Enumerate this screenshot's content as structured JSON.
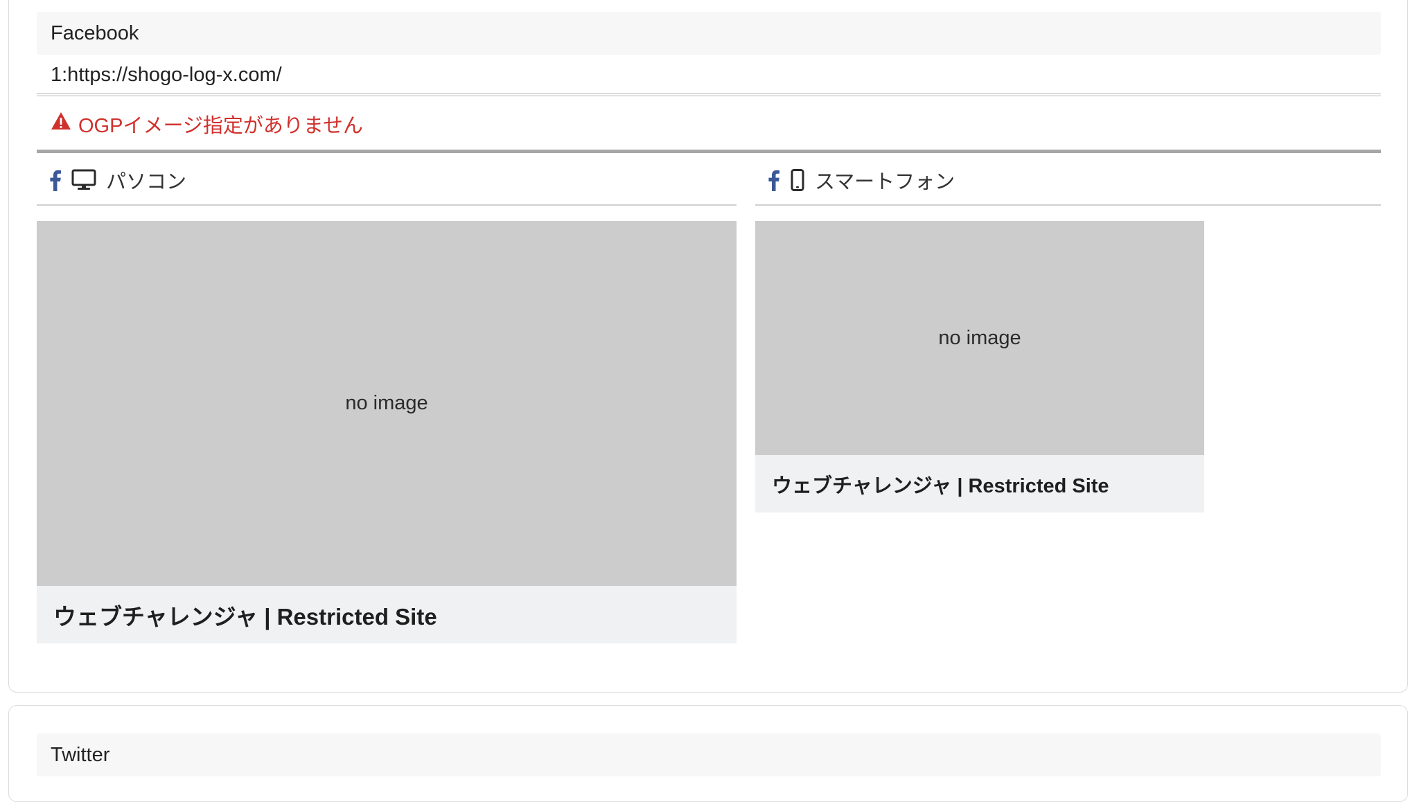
{
  "facebook": {
    "section_title": "Facebook",
    "url_line": "1:https://shogo-log-x.com/",
    "warning_text": "OGPイメージ指定がありません",
    "pc": {
      "label": "パソコン",
      "no_image": "no image",
      "title": "ウェブチャレンジャ | Restricted Site"
    },
    "smartphone": {
      "label": "スマートフォン",
      "no_image": "no image",
      "title": "ウェブチャレンジャ | Restricted Site"
    }
  },
  "twitter": {
    "section_title": "Twitter"
  },
  "colors": {
    "warning": "#d0312d",
    "facebook_blue": "#3b5998",
    "placeholder_gray": "#cccccc",
    "caption_bg": "#f0f1f3"
  },
  "icons": {
    "warning": "warning-triangle-icon",
    "facebook": "facebook-icon",
    "desktop": "desktop-monitor-icon",
    "mobile": "mobile-phone-icon"
  }
}
